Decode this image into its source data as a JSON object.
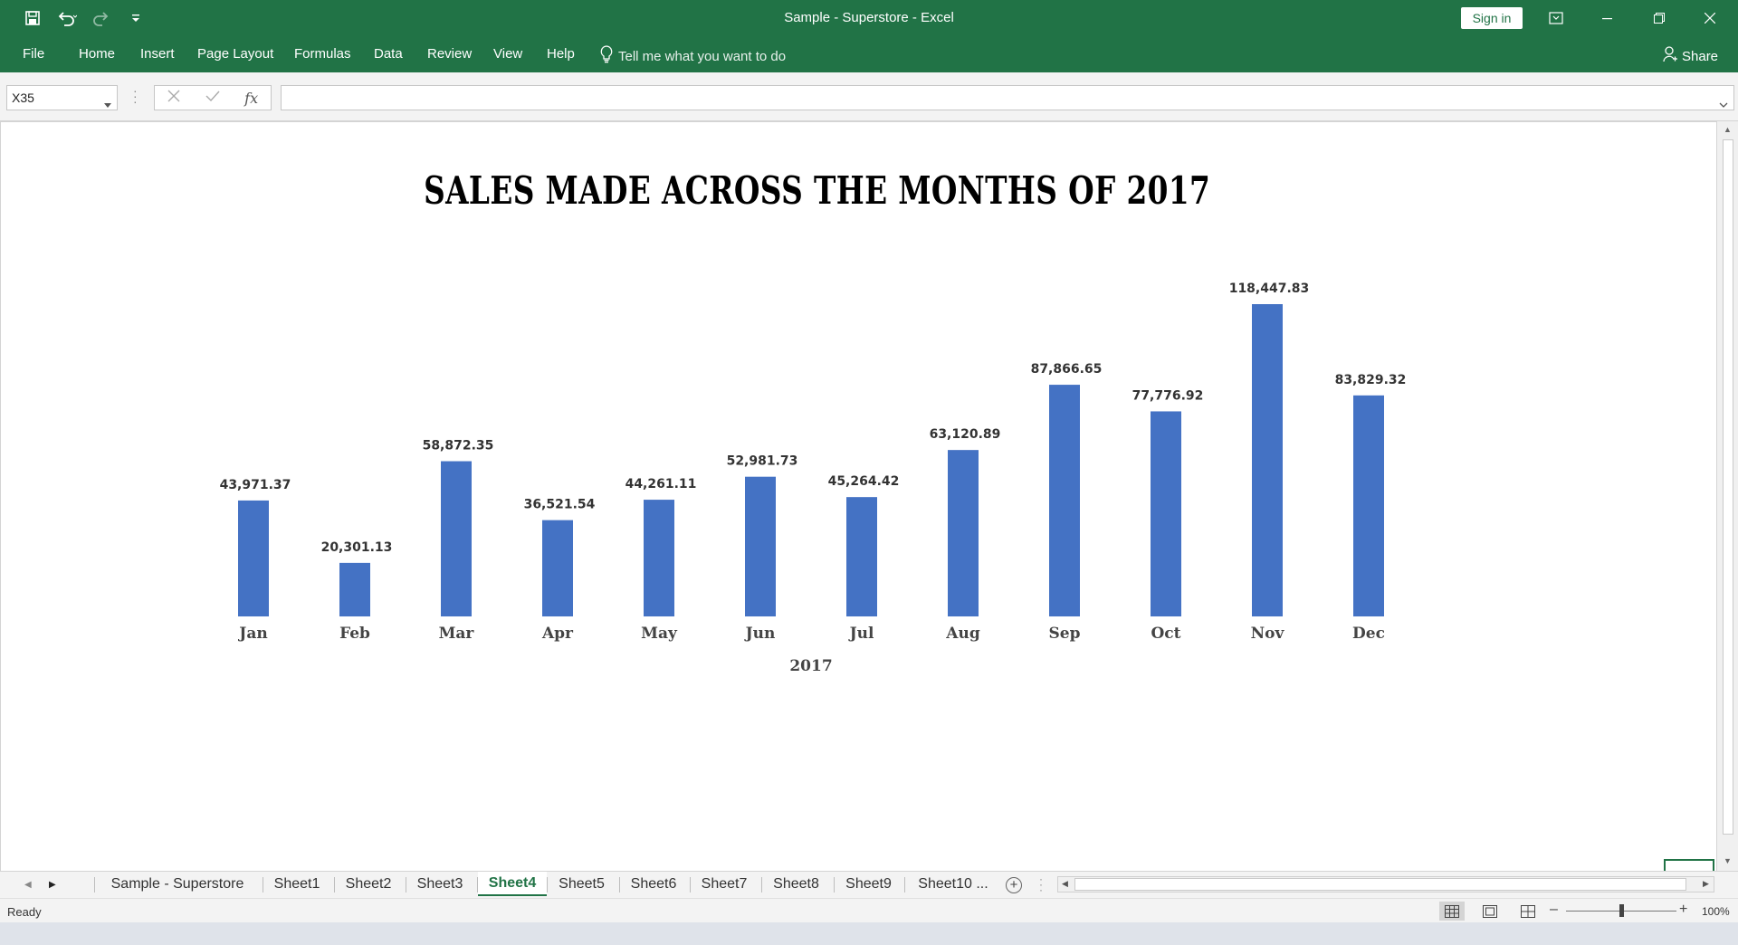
{
  "window": {
    "title": "Sample - Superstore  -  Excel",
    "signin_label": "Sign in"
  },
  "ribbon": {
    "tabs": [
      "File",
      "Home",
      "Insert",
      "Page Layout",
      "Formulas",
      "Data",
      "Review",
      "View",
      "Help"
    ],
    "tell_me": "Tell me what you want to do",
    "share_label": "Share"
  },
  "formula_bar": {
    "name_box": "X35",
    "fx_label": "fx",
    "formula": ""
  },
  "chart_data": {
    "type": "bar",
    "title": "SALES MADE ACROSS THE MONTHS OF 2017",
    "xlabel": "2017",
    "ylabel": "",
    "categories": [
      "Jan",
      "Feb",
      "Mar",
      "Apr",
      "May",
      "Jun",
      "Jul",
      "Aug",
      "Sep",
      "Oct",
      "Nov",
      "Dec"
    ],
    "values": [
      43971.37,
      20301.13,
      58872.35,
      36521.54,
      44261.11,
      52981.73,
      45264.42,
      63120.89,
      87866.65,
      77776.92,
      118447.83,
      83829.32
    ],
    "data_labels": [
      "43,971.37",
      "20,301.13",
      "58,872.35",
      "36,521.54",
      "44,261.11",
      "52,981.73",
      "45,264.42",
      "63,120.89",
      "87,866.65",
      "77,776.92",
      "118,447.83",
      "83,829.32"
    ],
    "ylim": [
      0,
      118447.83
    ],
    "grid": false,
    "legend": "none",
    "bar_color": "#4472C4"
  },
  "sheets": {
    "tabs": [
      "Sample - Superstore",
      "Sheet1",
      "Sheet2",
      "Sheet3",
      "Sheet4",
      "Sheet5",
      "Sheet6",
      "Sheet7",
      "Sheet8",
      "Sheet9",
      "Sheet10 ..."
    ],
    "active": "Sheet4"
  },
  "status": {
    "text": "Ready",
    "zoom": "100%"
  },
  "colors": {
    "accent": "#217346",
    "bar": "#4472C4"
  }
}
